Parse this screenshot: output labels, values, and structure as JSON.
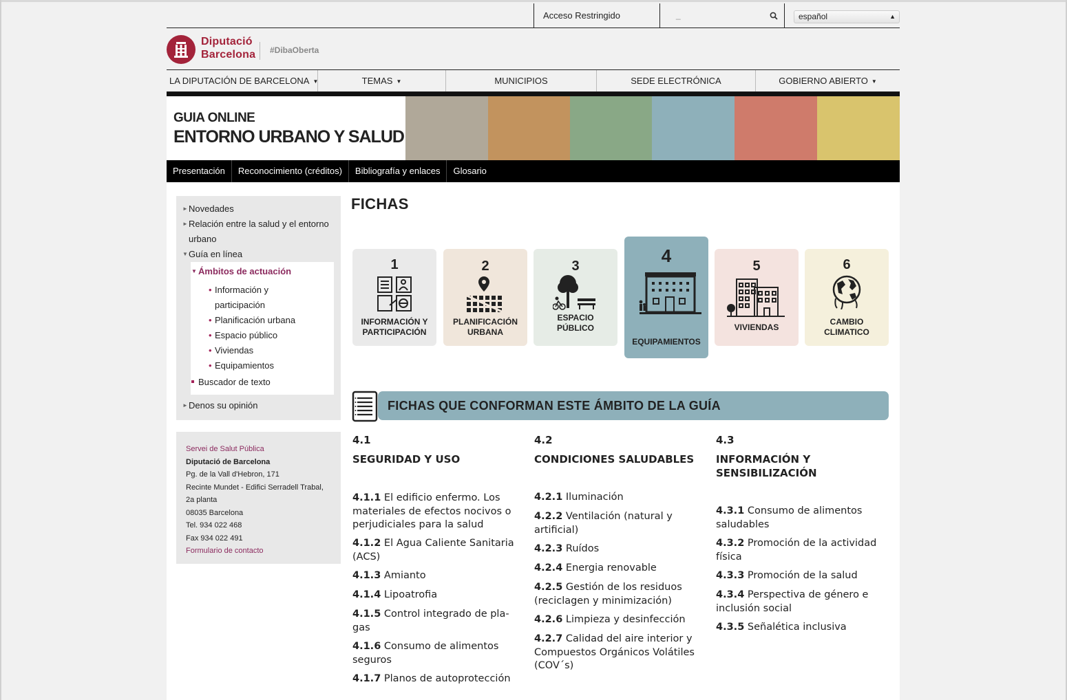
{
  "topbar": {
    "access_label": "Acceso Restringido",
    "search_placeholder": "_",
    "language": "español"
  },
  "logo": {
    "line1": "Diputació",
    "line2": "Barcelona",
    "tag": "#DibaOberta"
  },
  "main_nav": [
    {
      "label": "LA DIPUTACIÓN DE BARCELONA",
      "caret": true
    },
    {
      "label": "TEMAS",
      "caret": true
    },
    {
      "label": "MUNICIPIOS",
      "caret": false
    },
    {
      "label": "SEDE ELECTRÓNICA",
      "caret": false
    },
    {
      "label": "GOBIERNO ABIERTO",
      "caret": true
    }
  ],
  "banner": {
    "title1": "GUIA ONLINE",
    "title2": "ENTORNO URBANO Y SALUD",
    "swatches": [
      "#b0a899",
      "#c2935e",
      "#89a886",
      "#8eb0ba",
      "#cf7b6b",
      "#d9c46d"
    ]
  },
  "sub_nav": [
    "Presentación",
    "Reconocimiento (créditos)",
    "Bibliografía y enlaces",
    "Glosario"
  ],
  "sidebar": {
    "novedades": "Novedades",
    "relacion_1": "Relación entre la salud y el entorno",
    "relacion_2": "urbano",
    "guia": "Guía en línea",
    "ambitos": "Ámbitos de actuación",
    "items": [
      "Información y",
      "participación",
      "Planificación urbana",
      "Espacio público",
      "Viviendas",
      "Equipamientos"
    ],
    "buscador": "Buscador de texto",
    "opinion": "Denos su opinión"
  },
  "contact": {
    "service": "Servei de Salut Pública",
    "org": "Diputació de Barcelona",
    "address1": "Pg. de la Vall d'Hebron, 171",
    "address2": "Recinte Mundet - Edifici Serradell Trabal,",
    "address3": "2a planta",
    "city": "08035 Barcelona",
    "tel": "Tel. 934 022 468",
    "fax": "Fax 934 022 491",
    "form_link": "Formulario de contacto"
  },
  "fichas": {
    "title": "FICHAS",
    "cards": [
      {
        "num": "1",
        "label1": "INFORMACIÓN Y",
        "label2": "PARTICIPACIÓN",
        "color": "#eaeaea"
      },
      {
        "num": "2",
        "label1": "PLANIFICACIÓN",
        "label2": "URBANA",
        "color": "#f0e6db"
      },
      {
        "num": "3",
        "label1": "ESPACIO",
        "label2": "PÚBLICO",
        "color": "#e6ece6"
      },
      {
        "num": "4",
        "label1": "EQUIPAMIENTOS",
        "label2": "",
        "color": "#8eb0ba"
      },
      {
        "num": "5",
        "label1": "VIVIENDAS",
        "label2": "",
        "color": "#f4e3df"
      },
      {
        "num": "6",
        "label1": "CAMBIO",
        "label2": "CLIMATICO",
        "color": "#f5f0dc"
      }
    ],
    "section_heading": "FICHAS QUE CONFORMAN ESTE ÁMBITO DE LA GUÍA"
  },
  "columns": [
    {
      "code": "4.1",
      "head1": "SEGURIDAD Y USO",
      "head2": "",
      "items": [
        {
          "code": "4.1.1",
          "lines": [
            "El edificio enfermo. Los",
            "materiales de efectos nocivos o",
            "perjudiciales para la salud"
          ]
        },
        {
          "code": "4.1.2",
          "lines": [
            "El Agua Caliente Sanitaria",
            "(ACS)"
          ]
        },
        {
          "code": "4.1.3",
          "lines": [
            "Amianto"
          ]
        },
        {
          "code": "4.1.4",
          "lines": [
            "Lipoatrofia"
          ]
        },
        {
          "code": "4.1.5",
          "lines": [
            "Control integrado de pla-",
            "gas"
          ]
        },
        {
          "code": "4.1.6",
          "lines": [
            "Consumo de alimentos",
            "seguros"
          ]
        },
        {
          "code": "4.1.7",
          "lines": [
            "Planos de autoprotección"
          ]
        }
      ]
    },
    {
      "code": "4.2",
      "head1": "CONDICIONES SALUDABLES",
      "head2": "",
      "items": [
        {
          "code": "4.2.1",
          "lines": [
            "Iluminación"
          ]
        },
        {
          "code": "4.2.2",
          "lines": [
            "Ventilación (natural y",
            "artificial)"
          ]
        },
        {
          "code": "4.2.3",
          "lines": [
            "Ruídos"
          ]
        },
        {
          "code": "4.2.4",
          "lines": [
            "Energia renovable"
          ]
        },
        {
          "code": "4.2.5",
          "lines": [
            "Gestión de los residuos",
            "(reciclagen y minimización)"
          ]
        },
        {
          "code": "4.2.6",
          "lines": [
            "Limpieza y desinfección"
          ]
        },
        {
          "code": "4.2.7",
          "lines": [
            "Calidad del aire interior y",
            "Compuestos Orgánicos Volátiles",
            "(COV´s)"
          ]
        }
      ]
    },
    {
      "code": "4.3",
      "head1": "INFORMACIÓN Y",
      "head2": "SENSIBILIZACIÓN",
      "items": [
        {
          "code": "4.3.1",
          "lines": [
            "Consumo de alimentos",
            "saludables"
          ]
        },
        {
          "code": "4.3.2",
          "lines": [
            "Promoción de la actividad",
            "física"
          ]
        },
        {
          "code": "4.3.3",
          "lines": [
            "Promoción de la salud"
          ]
        },
        {
          "code": "4.3.4",
          "lines": [
            "Perspectiva de género e",
            "inclusión social"
          ]
        },
        {
          "code": "4.3.5",
          "lines": [
            "Señalética inclusiva"
          ]
        }
      ]
    }
  ]
}
